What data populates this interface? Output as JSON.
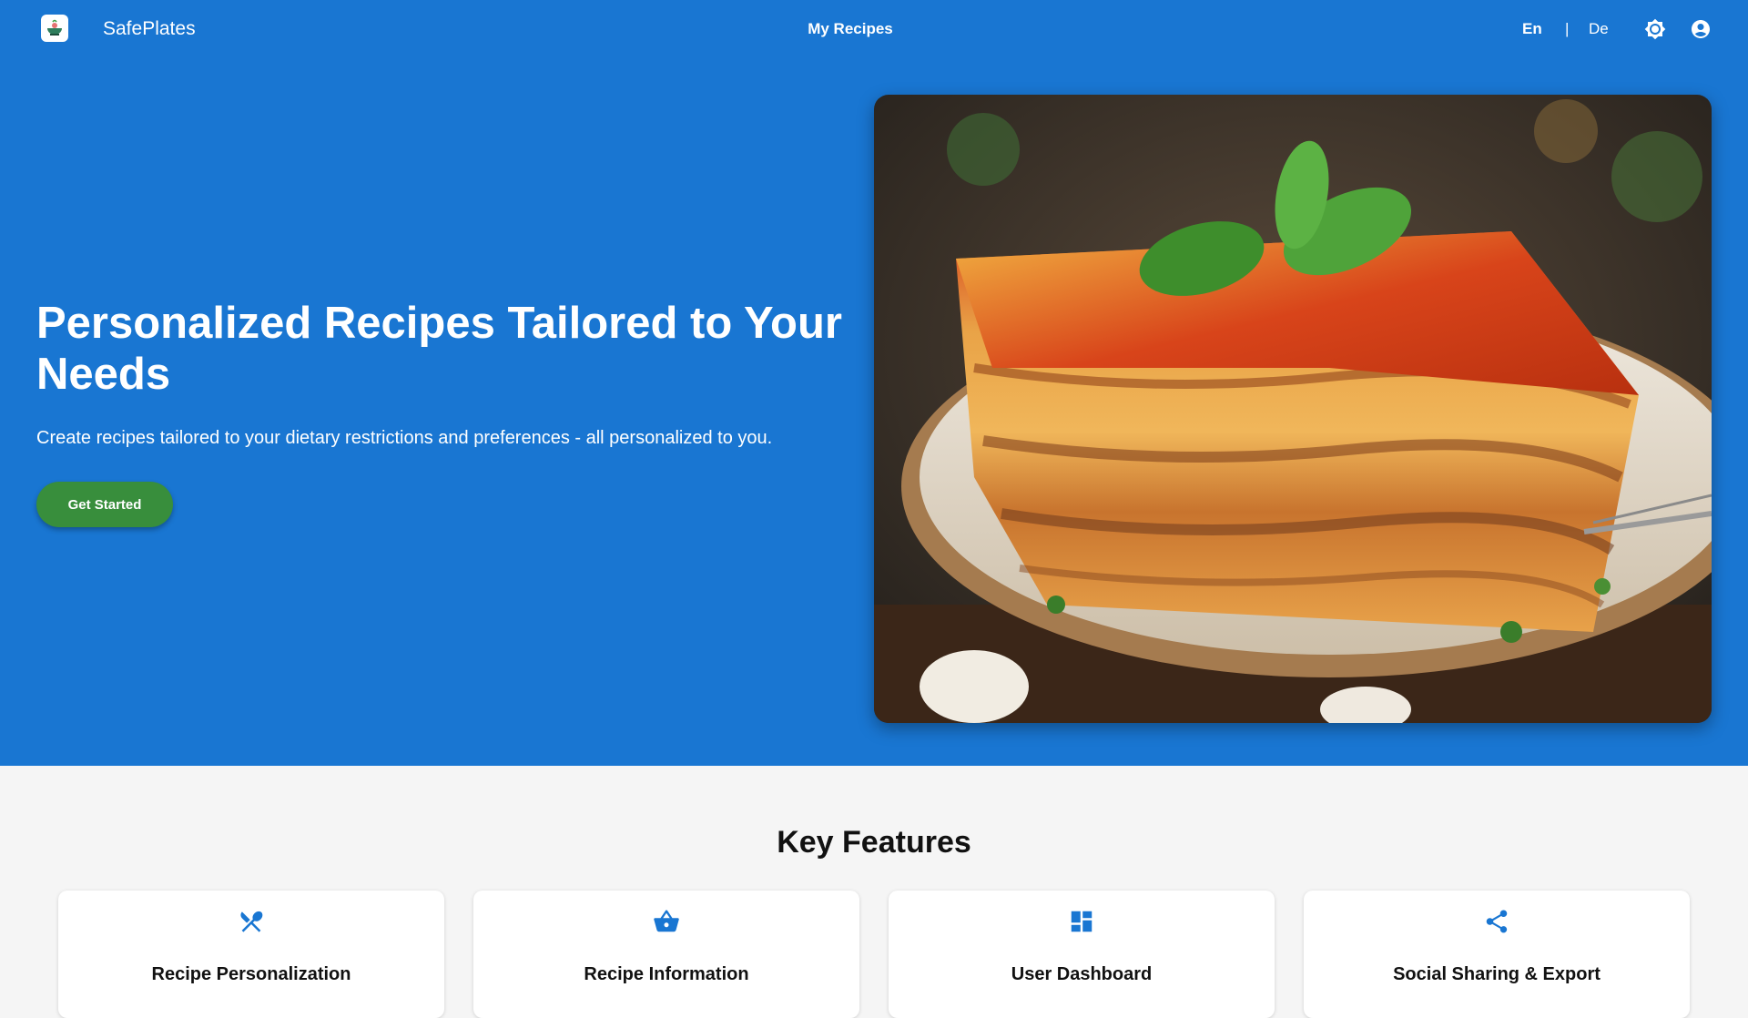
{
  "app": {
    "brand": "SafePlates",
    "logo_icon": "bowl-logo-icon"
  },
  "nav": {
    "center_link": "My Recipes",
    "lang_en": "En",
    "lang_separator": "|",
    "lang_de": "De",
    "theme_icon": "brightness-icon",
    "account_icon": "account-circle-icon"
  },
  "hero": {
    "title": "Personalized Recipes Tailored to Your Needs",
    "subtitle": "Create recipes tailored to your dietary restrictions and preferences - all personalized to you.",
    "cta_label": "Get Started",
    "image_alt": "lasagna-photo"
  },
  "features": {
    "heading": "Key Features",
    "items": [
      {
        "title": "Recipe Personalization",
        "icon": "utensils-icon"
      },
      {
        "title": "Recipe Information",
        "icon": "basket-icon"
      },
      {
        "title": "User Dashboard",
        "icon": "dashboard-icon"
      },
      {
        "title": "Social Sharing & Export",
        "icon": "share-icon"
      }
    ]
  },
  "colors": {
    "primary": "#1976d2",
    "cta": "#388e3c",
    "background": "#f5f5f5",
    "card": "#ffffff"
  }
}
